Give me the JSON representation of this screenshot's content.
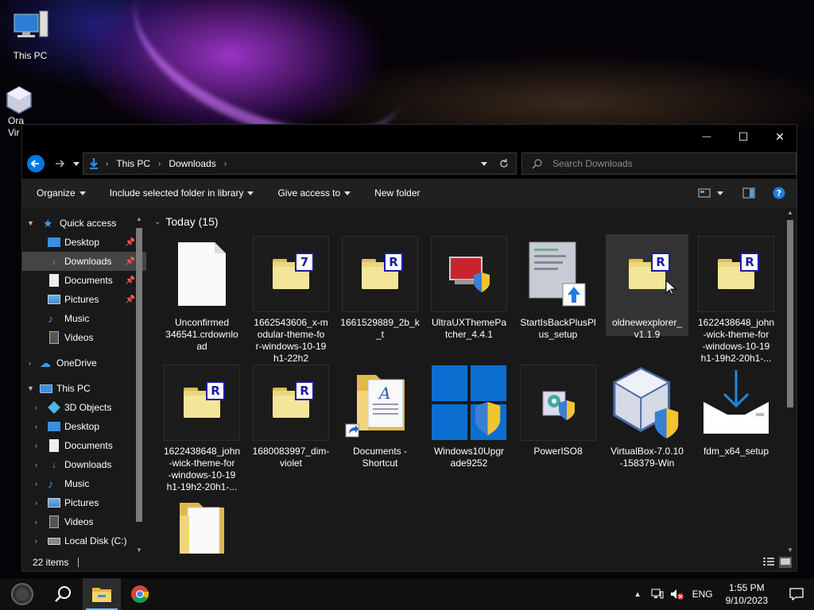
{
  "desktop": {
    "icons": [
      {
        "label": "This PC"
      },
      {
        "label": "Ora\nVir"
      }
    ]
  },
  "window": {
    "controls": {
      "minimize": "—",
      "maximize": "☐",
      "close": "✕"
    },
    "address": {
      "crumbs": [
        "This PC",
        "Downloads"
      ],
      "search_placeholder": "Search Downloads"
    },
    "toolbar": {
      "organize": "Organize",
      "include_library": "Include selected folder in library",
      "give_access": "Give access to",
      "new_folder": "New folder"
    },
    "nav": {
      "quick_access": "Quick access",
      "quick_items": [
        {
          "label": "Desktop",
          "pinned": true
        },
        {
          "label": "Downloads",
          "pinned": true,
          "selected": true
        },
        {
          "label": "Documents",
          "pinned": true
        },
        {
          "label": "Pictures",
          "pinned": true
        },
        {
          "label": "Music"
        },
        {
          "label": "Videos"
        }
      ],
      "onedrive": "OneDrive",
      "this_pc": "This PC",
      "pc_items": [
        "3D Objects",
        "Desktop",
        "Documents",
        "Downloads",
        "Music",
        "Pictures",
        "Videos",
        "Local Disk (C:)"
      ]
    },
    "content": {
      "group_title": "Today (15)",
      "files": [
        {
          "name": "Unconfirmed 346541.crdownload",
          "line1": "Unconfirmed",
          "line2": "346541.crdownlo",
          "line3": "ad"
        },
        {
          "name": "1662543606_x-modular-theme-for-windows-10-19h1-22h2",
          "line1": "1662543606_x-m",
          "line2": "odular-theme-fo",
          "line3": "r-windows-10-19",
          "line4": "h1-22h2",
          "badge": "7"
        },
        {
          "name": "1661529889_2b_k_t",
          "line1": "1661529889_2b_k",
          "line2": "_t",
          "badge": "R"
        },
        {
          "name": "UltraUXThemePatcher_4.4.1",
          "line1": "UltraUXThemePa",
          "line2": "tcher_4.4.1"
        },
        {
          "name": "StartIsBackPlusPlus_setup",
          "line1": "StartIsBackPlusPl",
          "line2": "us_setup"
        },
        {
          "name": "oldnewexplorer_v1.1.9",
          "line1": "oldnewexplorer_",
          "line2": "v1.1.9",
          "badge": "R"
        },
        {
          "name": "1622438648_john-wick-theme-for-windows-10-19h1-20h1",
          "line1": "1622438648_john",
          "line2": "-wick-theme-for",
          "line3": "-windows-10-19",
          "line4": "h1-19h2-20h1-...",
          "badge": "R"
        },
        {
          "name": "1622438648_john-wick-theme-for-windows-10-19h1-20h1 copy",
          "line1": "1622438648_john",
          "line2": "-wick-theme-for",
          "line3": "-windows-10-19",
          "line4": "h1-19h2-20h1-...",
          "badge": "R"
        },
        {
          "name": "1680083997_dim-violet",
          "line1": "1680083997_dim-",
          "line2": "violet",
          "badge": "R"
        },
        {
          "name": "Documents - Shortcut",
          "line1": "Documents -",
          "line2": "Shortcut"
        },
        {
          "name": "Windows10Upgrade9252",
          "line1": "Windows10Upgr",
          "line2": "ade9252"
        },
        {
          "name": "PowerISO8",
          "line1": "PowerISO8"
        },
        {
          "name": "VirtualBox-7.0.10-158379-Win",
          "line1": "VirtualBox-7.0.10",
          "line2": "-158379-Win"
        },
        {
          "name": "fdm_x64_setup",
          "line1": "fdm_x64_setup"
        }
      ]
    },
    "status": {
      "items": "22 items"
    }
  },
  "taskbar": {
    "tray": {
      "language": "ENG",
      "time": "1:55 PM",
      "date": "9/10/2023"
    }
  },
  "colors": {
    "accent": "#0078d7",
    "folder": "#f3e59a",
    "badge": "#1a1aa6"
  }
}
